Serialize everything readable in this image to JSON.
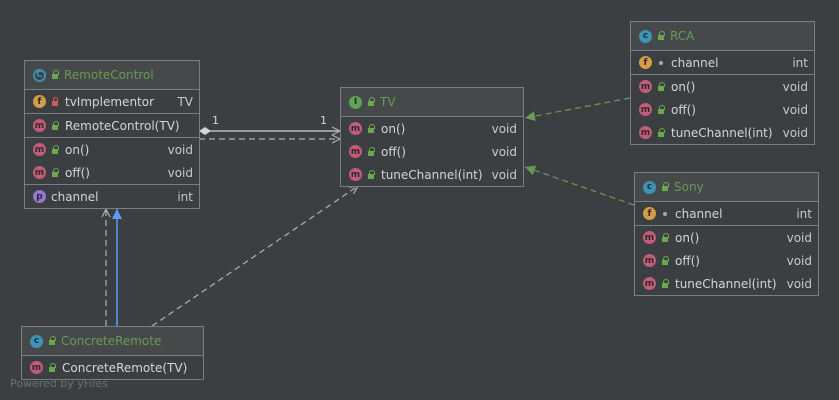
{
  "colors": {
    "background": "#3c3f41",
    "node_header": "#45494a",
    "node_border": "#7a7e82",
    "class_name": "#6a9955",
    "realization_edge": "#6a9955",
    "dependency_edge": "#b0b0b0",
    "generalization_edge": "#5a9cff"
  },
  "nodes": {
    "remote_control": {
      "kind": "class",
      "icon": "class-abstract-icon",
      "name": "RemoteControl",
      "fields": [
        {
          "badge": "f",
          "visibility": "private",
          "name": "tvImplementor",
          "type": "TV"
        }
      ],
      "constructors": [
        {
          "badge": "m",
          "visibility": "public",
          "name": "RemoteControl(TV)",
          "type": ""
        }
      ],
      "methods": [
        {
          "badge": "m",
          "visibility": "public",
          "name": "on()",
          "type": "void"
        },
        {
          "badge": "m",
          "visibility": "public",
          "name": "off()",
          "type": "void"
        }
      ],
      "properties": [
        {
          "badge": "p",
          "visibility": "",
          "name": "channel",
          "type": "int"
        }
      ]
    },
    "tv": {
      "kind": "interface",
      "icon": "interface-icon",
      "name": "TV",
      "methods": [
        {
          "badge": "m",
          "visibility": "public",
          "name": "on()",
          "type": "void"
        },
        {
          "badge": "m",
          "visibility": "public",
          "name": "off()",
          "type": "void"
        },
        {
          "badge": "m",
          "visibility": "public",
          "name": "tuneChannel(int)",
          "type": "void"
        }
      ]
    },
    "rca": {
      "kind": "class",
      "icon": "class-icon",
      "name": "RCA",
      "fields": [
        {
          "badge": "f",
          "visibility": "package",
          "name": "channel",
          "type": "int"
        }
      ],
      "methods": [
        {
          "badge": "m",
          "visibility": "public",
          "name": "on()",
          "type": "void"
        },
        {
          "badge": "m",
          "visibility": "public",
          "name": "off()",
          "type": "void"
        },
        {
          "badge": "m",
          "visibility": "public",
          "name": "tuneChannel(int)",
          "type": "void"
        }
      ]
    },
    "sony": {
      "kind": "class",
      "icon": "class-icon",
      "name": "Sony",
      "fields": [
        {
          "badge": "f",
          "visibility": "package",
          "name": "channel",
          "type": "int"
        }
      ],
      "methods": [
        {
          "badge": "m",
          "visibility": "public",
          "name": "on()",
          "type": "void"
        },
        {
          "badge": "m",
          "visibility": "public",
          "name": "off()",
          "type": "void"
        },
        {
          "badge": "m",
          "visibility": "public",
          "name": "tuneChannel(int)",
          "type": "void"
        }
      ]
    },
    "concrete_remote": {
      "kind": "class",
      "icon": "class-icon",
      "name": "ConcreteRemote",
      "constructors": [
        {
          "badge": "m",
          "visibility": "public",
          "name": "ConcreteRemote(TV)",
          "type": ""
        }
      ]
    }
  },
  "edges": {
    "composition_source_multiplicity": "1",
    "composition_target_multiplicity": "1"
  },
  "watermark": "Powered by yFiles"
}
